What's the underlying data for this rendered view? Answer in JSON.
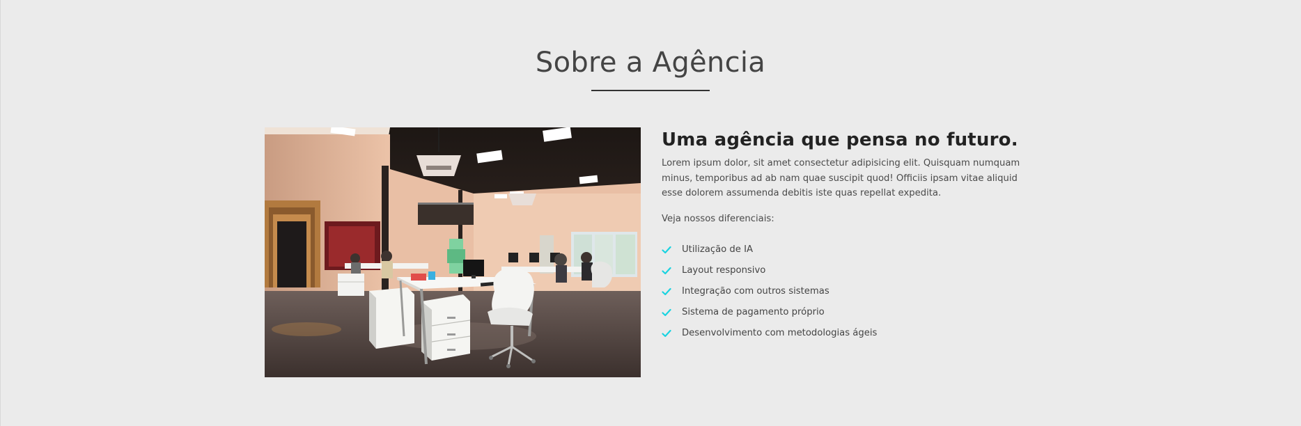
{
  "section": {
    "title": "Sobre a Agência"
  },
  "photo": {
    "icon": "office-photo"
  },
  "about": {
    "subtitle": "Uma agência que pensa no futuro.",
    "description": "Lorem ipsum dolor, sit amet consectetur adipisicing elit. Quisquam numquam minus, temporibus ad ab nam quae suscipit quod! Officiis ipsam vitae aliquid esse dolorem assumenda debitis iste quas repellat expedita.",
    "intro": "Veja nossos diferenciais:",
    "features": [
      {
        "label": "Utilização de IA",
        "icon": "check-icon"
      },
      {
        "label": "Layout responsivo",
        "icon": "check-icon"
      },
      {
        "label": "Integração com outros sistemas",
        "icon": "check-icon"
      },
      {
        "label": "Sistema de pagamento próprio",
        "icon": "check-icon"
      },
      {
        "label": "Desenvolvimento com metodologias ágeis",
        "icon": "check-icon"
      }
    ]
  },
  "colors": {
    "background": "#ebebeb",
    "check_accent": "#19d3e0",
    "title": "#444444",
    "underline": "#333333"
  }
}
